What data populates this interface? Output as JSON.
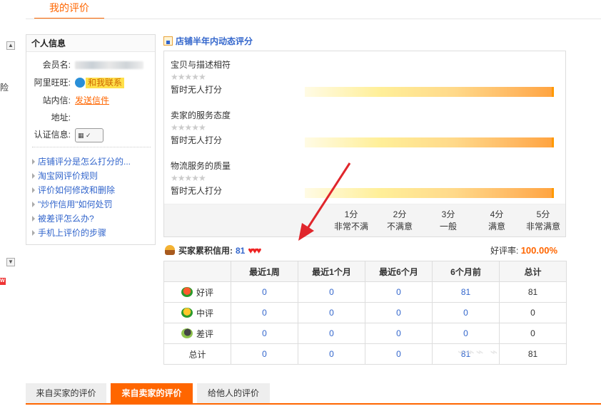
{
  "page_tab": "我的评价",
  "edge": {
    "up_icon": "▲",
    "down_icon": "▼",
    "clipped_text": "险",
    "badge": "W"
  },
  "personal_info": {
    "title": "个人信息",
    "member_label": "会员名:",
    "wangwang_label": "阿里旺旺:",
    "wangwang_button": "和我联系",
    "message_label": "站内信:",
    "message_link": "发送信件",
    "address_label": "地址:",
    "cert_label": "认证信息:",
    "help_links": [
      "店铺评分是怎么打分的...",
      "淘宝网评价规则",
      "评价如何修改和删除",
      "\"炒作信用\"如何处罚",
      "被差评怎么办?",
      "手机上评价的步骤"
    ]
  },
  "dynamic_rating": {
    "title": "店铺半年内动态评分",
    "metrics": [
      {
        "name": "宝贝与描述相符",
        "stars": "★★★★★",
        "status": "暂时无人打分",
        "level": null
      },
      {
        "name": "卖家的服务态度",
        "stars": "★★★★★",
        "status": "暂时无人打分",
        "level": null
      },
      {
        "name": "物流服务的质量",
        "stars": "★★★★★",
        "status": "暂时无人打分",
        "level": null
      }
    ],
    "scale": [
      {
        "score": "1分",
        "desc": "非常不满"
      },
      {
        "score": "2分",
        "desc": "不满意"
      },
      {
        "score": "3分",
        "desc": "一般"
      },
      {
        "score": "4分",
        "desc": "满意"
      },
      {
        "score": "5分",
        "desc": "非常满意"
      }
    ]
  },
  "buyer_credit": {
    "label": "买家累积信用:",
    "value": "81",
    "hearts": "♥♥♥",
    "rate_label": "好评率:",
    "rate_value": "100.00%"
  },
  "ratings_table": {
    "headers": [
      "",
      "最近1周",
      "最近1个月",
      "最近6个月",
      "6个月前",
      "总计"
    ],
    "rows": [
      {
        "label": "好评",
        "icon": "flower-good-icon",
        "values": [
          "0",
          "0",
          "0",
          "81",
          "81"
        ]
      },
      {
        "label": "中评",
        "icon": "flower-neutral-icon",
        "values": [
          "0",
          "0",
          "0",
          "0",
          "0"
        ]
      },
      {
        "label": "差评",
        "icon": "flower-bad-icon",
        "values": [
          "0",
          "0",
          "0",
          "0",
          "0"
        ]
      },
      {
        "label": "总计",
        "icon": "",
        "values": [
          "0",
          "0",
          "0",
          "81",
          "81"
        ]
      }
    ]
  },
  "bottom_tabs": [
    {
      "label": "来自买家的评价",
      "active": false
    },
    {
      "label": "来自卖家的评价",
      "active": true
    },
    {
      "label": "给他人的评价",
      "active": false
    }
  ],
  "colors": {
    "accent": "#ff6600",
    "link": "#3366cc",
    "heart": "#ee2222"
  }
}
